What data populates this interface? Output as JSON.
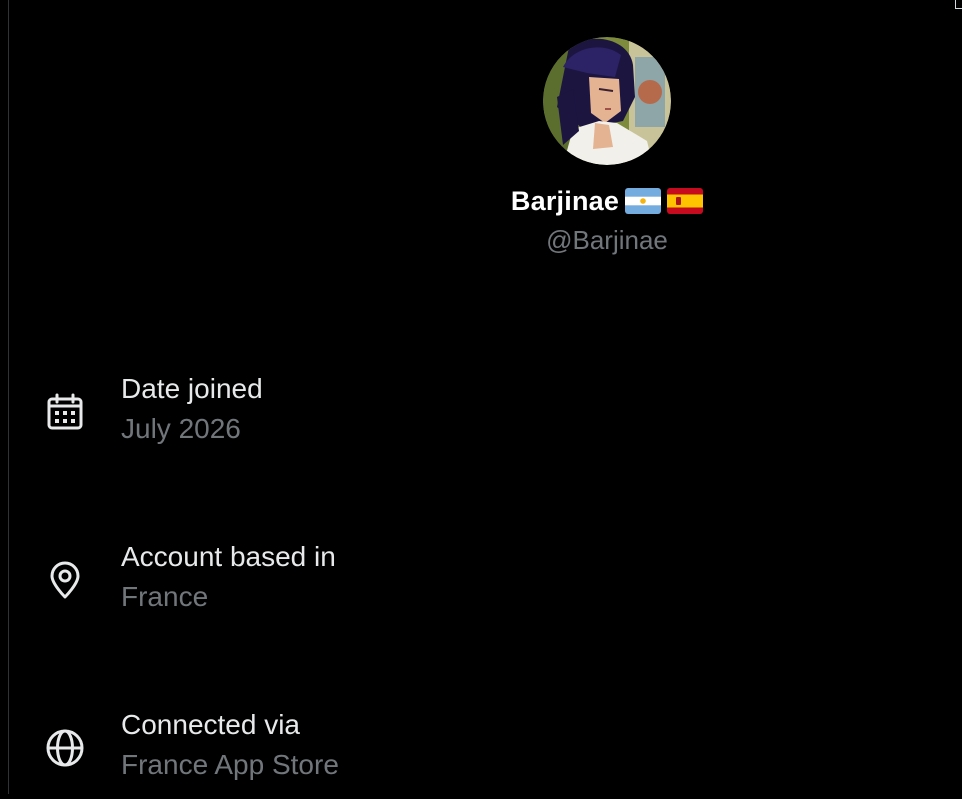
{
  "profile": {
    "display_name": "Barjinae",
    "handle": "@Barjinae",
    "flags": [
      "argentina-flag",
      "spain-flag"
    ]
  },
  "about": {
    "date_joined": {
      "label": "Date joined",
      "value": "July 2026",
      "icon": "calendar-icon"
    },
    "account_based": {
      "label": "Account based in",
      "value": "France",
      "icon": "location-pin-icon"
    },
    "connected_via": {
      "label": "Connected via",
      "value": "France App Store",
      "icon": "globe-icon"
    }
  },
  "colors": {
    "background": "#000000",
    "primary_text": "#e7e9ea",
    "secondary_text": "#71767b"
  }
}
